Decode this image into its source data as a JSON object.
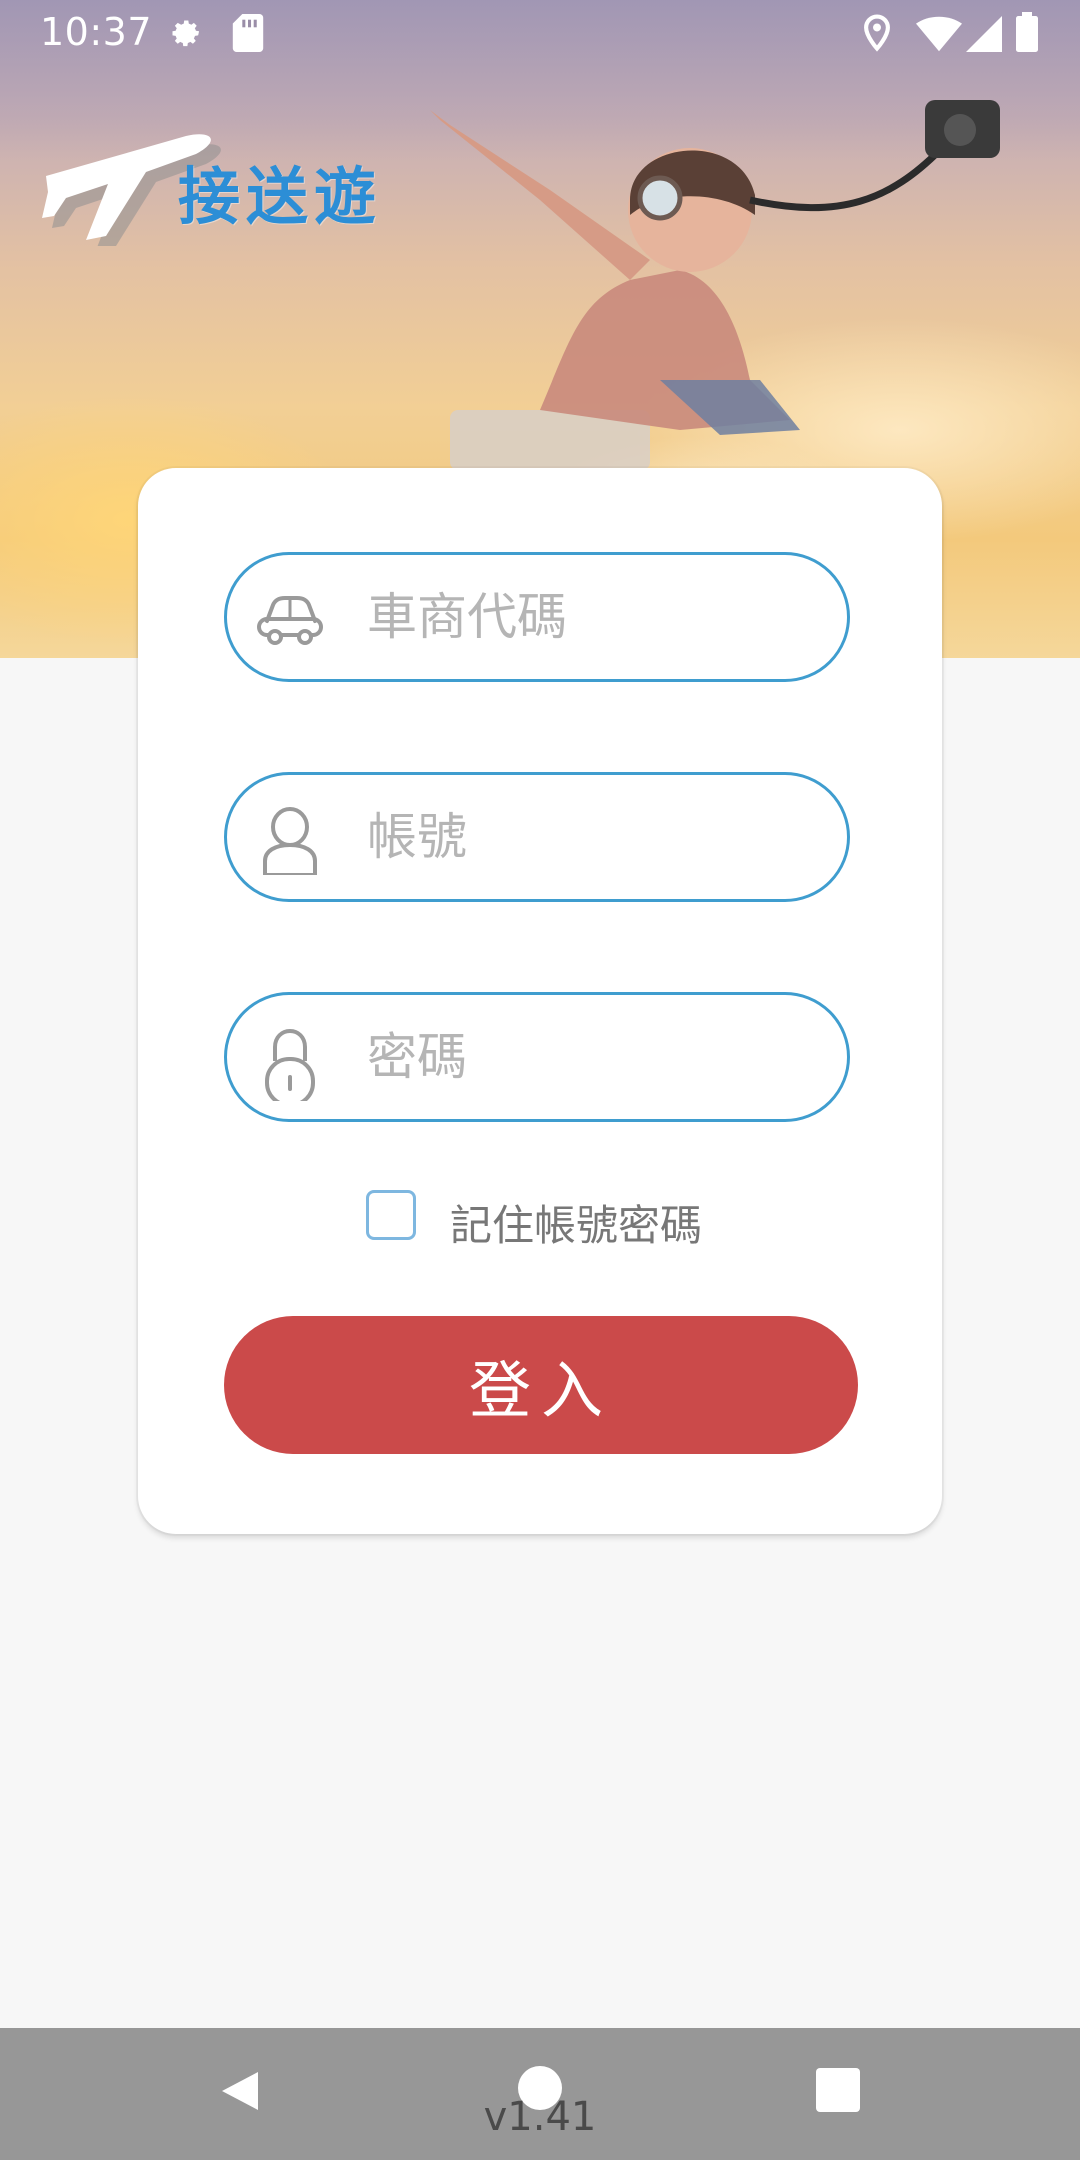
{
  "status_bar": {
    "time": "10:37",
    "icons": [
      "settings-icon",
      "sd-card-icon",
      "location-icon",
      "wifi-icon",
      "signal-icon",
      "battery-icon"
    ]
  },
  "header": {
    "logo_text": "接送遊",
    "logo_icon": "airplane-icon"
  },
  "login_form": {
    "company_code_placeholder": "車商代碼",
    "company_code_value": "",
    "account_placeholder": "帳號",
    "account_value": "",
    "password_placeholder": "密碼",
    "password_value": "",
    "remember_label": "記住帳號密碼",
    "remember_checked": false,
    "login_label": "登入"
  },
  "nav_bar": {
    "buttons": [
      "back-icon",
      "home-icon",
      "recents-icon"
    ]
  },
  "version": "v1.41",
  "colors": {
    "accent_blue": "#3f9dcf",
    "login_red": "#cb4a4a",
    "logo_blue": "#2c8ed6"
  }
}
